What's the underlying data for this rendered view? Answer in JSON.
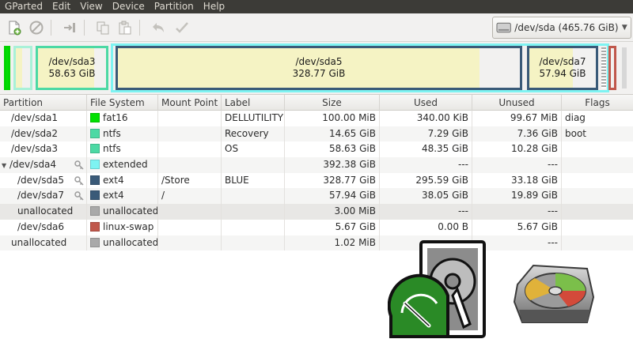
{
  "menubar": {
    "items": [
      "GParted",
      "Edit",
      "View",
      "Device",
      "Partition",
      "Help"
    ]
  },
  "toolbar": {
    "buttons": [
      "new-icon",
      "delete-icon",
      "resize-move-icon",
      "copy-icon",
      "paste-icon",
      "undo-icon",
      "apply-icon"
    ],
    "device_selector": "/dev/sda   (465.76 GiB)"
  },
  "diskmap": {
    "segments": [
      {
        "name": "sda1",
        "border": "#00d400",
        "fill": "#00e000"
      },
      {
        "name": "sda2",
        "border": "#5fe0b0",
        "fill": "#ffffff"
      },
      {
        "name": "sda3",
        "border": "#4cd9a4",
        "fill": "#f5f3c4",
        "label": "/dev/sda3",
        "size": "58.63 GiB"
      },
      {
        "name": "sda4",
        "border": "#7ef3f2"
      },
      {
        "name": "sda5",
        "border": "#3a5a78",
        "fill": "#f5f3c4",
        "label": "/dev/sda5",
        "size": "328.77 GiB"
      },
      {
        "name": "sda7",
        "border": "#3a5a78",
        "fill": "#f5f3c4",
        "label": "/dev/sda7",
        "size": "57.94 GiB"
      },
      {
        "name": "sda6",
        "border": "#c0584c"
      }
    ]
  },
  "table": {
    "headers": [
      "Partition",
      "File System",
      "Mount Point",
      "Label",
      "Size",
      "Used",
      "Unused",
      "Flags"
    ],
    "rows": [
      {
        "partition": "/dev/sda1",
        "fs": "fat16",
        "fs_color": "#00e000",
        "mount": "",
        "label": "DELLUTILITY",
        "size": "100.00 MiB",
        "used": "340.00 KiB",
        "unused": "99.67 MiB",
        "flags": "diag"
      },
      {
        "partition": "/dev/sda2",
        "fs": "ntfs",
        "fs_color": "#4cd9a4",
        "mount": "",
        "label": "Recovery",
        "size": "14.65 GiB",
        "used": "7.29 GiB",
        "unused": "7.36 GiB",
        "flags": "boot"
      },
      {
        "partition": "/dev/sda3",
        "fs": "ntfs",
        "fs_color": "#4cd9a4",
        "mount": "",
        "label": "OS",
        "size": "58.63 GiB",
        "used": "48.35 GiB",
        "unused": "10.28 GiB",
        "flags": ""
      },
      {
        "partition": "/dev/sda4",
        "fs": "extended",
        "fs_color": "#7ef3f2",
        "mount": "",
        "label": "",
        "size": "392.38 GiB",
        "used": "---",
        "unused": "---",
        "flags": ""
      },
      {
        "partition": "/dev/sda5",
        "fs": "ext4",
        "fs_color": "#3a5a78",
        "mount": "/Store",
        "label": "BLUE",
        "size": "328.77 GiB",
        "used": "295.59 GiB",
        "unused": "33.18 GiB",
        "flags": ""
      },
      {
        "partition": "/dev/sda7",
        "fs": "ext4",
        "fs_color": "#3a5a78",
        "mount": "/",
        "label": "",
        "size": "57.94 GiB",
        "used": "38.05 GiB",
        "unused": "19.89 GiB",
        "flags": ""
      },
      {
        "partition": "unallocated",
        "fs": "unallocated",
        "fs_color": "#a9a9a9",
        "mount": "",
        "label": "",
        "size": "3.00 MiB",
        "used": "---",
        "unused": "---",
        "flags": ""
      },
      {
        "partition": "/dev/sda6",
        "fs": "linux-swap",
        "fs_color": "#c0584c",
        "mount": "",
        "label": "",
        "size": "5.67 GiB",
        "used": "0.00 B",
        "unused": "5.67 GiB",
        "flags": ""
      },
      {
        "partition": "unallocated",
        "fs": "unallocated",
        "fs_color": "#a9a9a9",
        "mount": "",
        "label": "",
        "size": "1.02 MiB",
        "used": "---",
        "unused": "---",
        "flags": ""
      }
    ]
  },
  "colors": {
    "menubar_bg": "#3c3b37",
    "logo_green": "#2a8a26",
    "logo_gray": "#8c8c8c"
  }
}
